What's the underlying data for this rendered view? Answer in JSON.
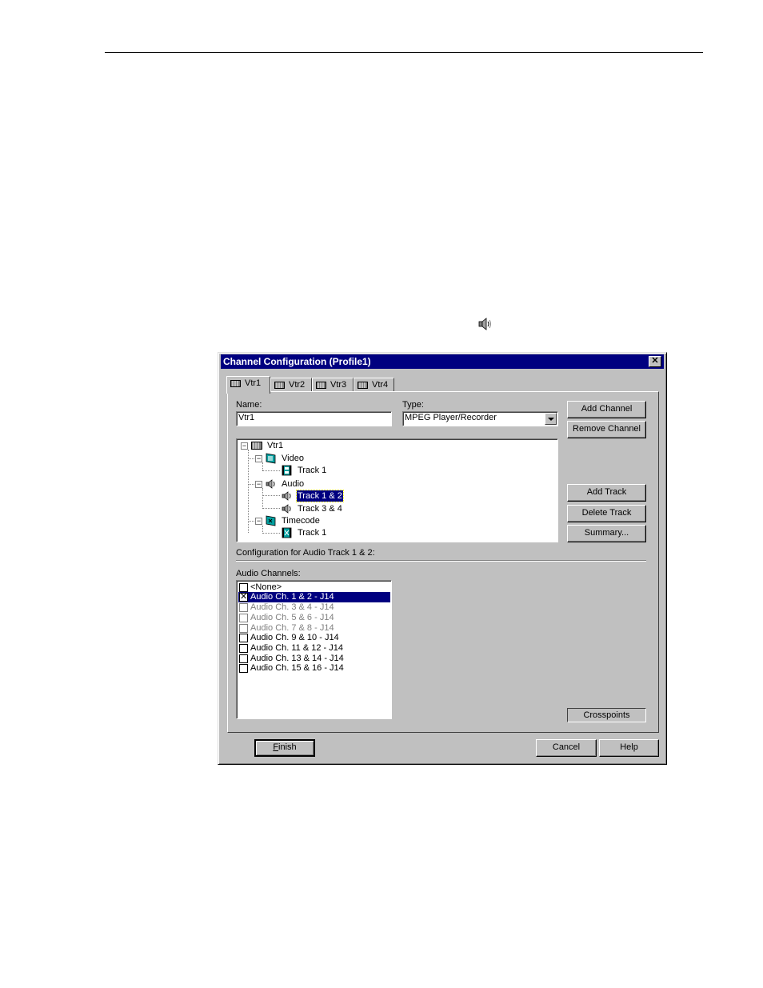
{
  "dialog": {
    "title": "Channel Configuration (Profile1)",
    "close_glyph": "✕",
    "tabs": [
      {
        "label": "Vtr1",
        "icon": "vtr-icon",
        "active": true
      },
      {
        "label": "Vtr2",
        "icon": "vtr-icon",
        "active": false
      },
      {
        "label": "Vtr3",
        "icon": "vtr-icon",
        "active": false
      },
      {
        "label": "Vtr4",
        "icon": "vtr-icon",
        "active": false
      }
    ],
    "name_label": "Name:",
    "name_value": "Vtr1",
    "type_label": "Type:",
    "type_value": "MPEG Player/Recorder",
    "buttons": {
      "add_channel": "Add Channel",
      "remove_channel": "Remove Channel",
      "add_track": "Add Track",
      "delete_track": "Delete Track",
      "summary": "Summary...",
      "crosspoints": "Crosspoints",
      "finish": "Finish",
      "cancel": "Cancel",
      "help": "Help"
    },
    "tree": {
      "root": "Vtr1",
      "video": "Video",
      "video_track1": "Track 1",
      "audio": "Audio",
      "audio_track12": "Track 1 & 2",
      "audio_track34": "Track 3 & 4",
      "timecode": "Timecode",
      "timecode_track1": "Track 1",
      "expand_glyph": "−"
    },
    "config_label": "Configuration for Audio Track 1 & 2:",
    "audio_channels_label": "Audio Channels:",
    "audio_channels": [
      {
        "label": "<None>",
        "checked": false,
        "enabled": true,
        "selected": false
      },
      {
        "label": "Audio Ch. 1 & 2 - J14",
        "checked": true,
        "enabled": true,
        "selected": true
      },
      {
        "label": "Audio Ch. 3 & 4 - J14",
        "checked": false,
        "enabled": false,
        "selected": false
      },
      {
        "label": "Audio Ch. 5 & 6 - J14",
        "checked": false,
        "enabled": false,
        "selected": false
      },
      {
        "label": "Audio Ch. 7 & 8 - J14",
        "checked": false,
        "enabled": false,
        "selected": false
      },
      {
        "label": "Audio Ch. 9 & 10 - J14",
        "checked": false,
        "enabled": true,
        "selected": false
      },
      {
        "label": "Audio Ch. 11 & 12 - J14",
        "checked": false,
        "enabled": true,
        "selected": false
      },
      {
        "label": "Audio Ch. 13 & 14 - J14",
        "checked": false,
        "enabled": true,
        "selected": false
      },
      {
        "label": "Audio Ch. 15 & 16 - J14",
        "checked": false,
        "enabled": true,
        "selected": false
      }
    ],
    "checkmark_glyph": "✕"
  },
  "colors": {
    "titlebar": "#000080",
    "face": "#c0c0c0",
    "selection": "#000080"
  }
}
